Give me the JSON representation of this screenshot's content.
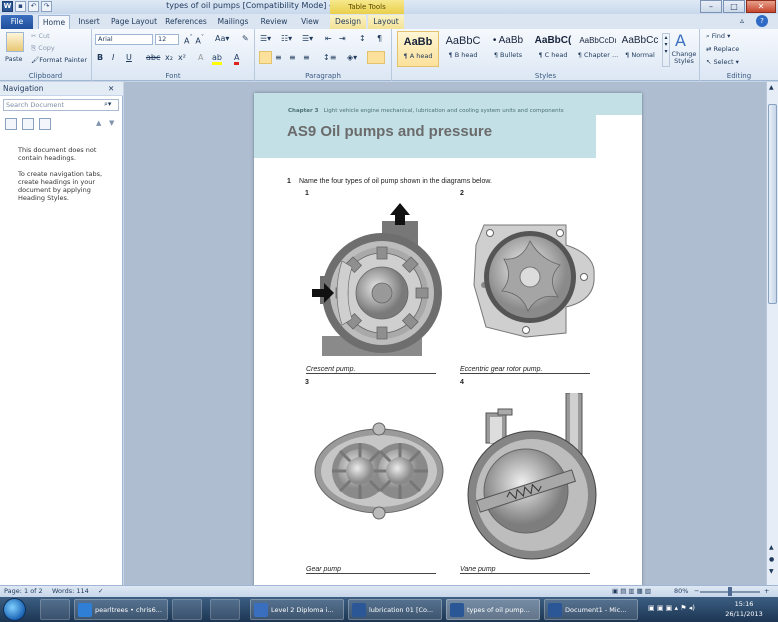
{
  "window": {
    "title": "types of oil pumps [Compatibility Mode] - Microsoft Word",
    "table_tools_label": "Table Tools",
    "minimize": "–",
    "maximize": "□",
    "close": "✕"
  },
  "tabs": [
    "File",
    "Home",
    "Insert",
    "Page Layout",
    "References",
    "Mailings",
    "Review",
    "View",
    "Design",
    "Layout"
  ],
  "ribbon": {
    "clipboard": {
      "label": "Clipboard",
      "paste": "Paste",
      "cut": "Cut",
      "copy": "Copy",
      "format_painter": "Format Painter"
    },
    "font": {
      "label": "Font",
      "font_name": "Arial",
      "font_size": "12"
    },
    "paragraph": {
      "label": "Paragraph"
    },
    "styles": {
      "label": "Styles",
      "items": [
        {
          "preview": "AaBb",
          "name": "¶ A head"
        },
        {
          "preview": "AaBbC",
          "name": "¶ B head"
        },
        {
          "preview": "• AaBb",
          "name": "¶ Bullets"
        },
        {
          "preview": "AaBbC(",
          "name": "¶ C head"
        },
        {
          "preview": "AaBbCcDı",
          "name": "¶ Chapter ..."
        },
        {
          "preview": "AaBbCc",
          "name": "¶ Normal"
        }
      ],
      "change_styles": "Change Styles"
    },
    "editing": {
      "label": "Editing",
      "find": "Find",
      "replace": "Replace",
      "select": "Select"
    }
  },
  "navigation": {
    "title": "Navigation",
    "search_placeholder": "Search Document",
    "message1": "This document does not contain headings.",
    "message2": "To create navigation tabs, create headings in your document by applying Heading Styles."
  },
  "document": {
    "chapter_label": "Chapter 3",
    "chapter_text": "Light vehicle engine mechanical, lubrication and cooling system units and components",
    "title": "AS9 Oil pumps and pressure",
    "question_number": "1",
    "question_text": "Name the four types of oil pump shown in the diagrams below.",
    "diagrams": [
      {
        "number": "1",
        "caption": "Crescent pump."
      },
      {
        "number": "2",
        "caption": "Eccentric gear rotor pump."
      },
      {
        "number": "3",
        "caption": "Gear pump"
      },
      {
        "number": "4",
        "caption": "Vane pump"
      }
    ]
  },
  "status": {
    "page": "Page: 1 of 2",
    "words": "Words: 114",
    "zoom": "80%"
  },
  "taskbar": {
    "items": [
      {
        "label": "pearltrees • chris6...",
        "color": "#2f7fd6"
      },
      {
        "label": "Level 2 Diploma i...",
        "color": "#3a6fc0"
      },
      {
        "label": "lubrication 01 [Co...",
        "color": "#2b5797"
      },
      {
        "label": "types of oil pump...",
        "color": "#2b5797"
      },
      {
        "label": "Document1 - Mic...",
        "color": "#2b5797"
      }
    ],
    "time": "15:16",
    "date": "26/11/2013"
  }
}
